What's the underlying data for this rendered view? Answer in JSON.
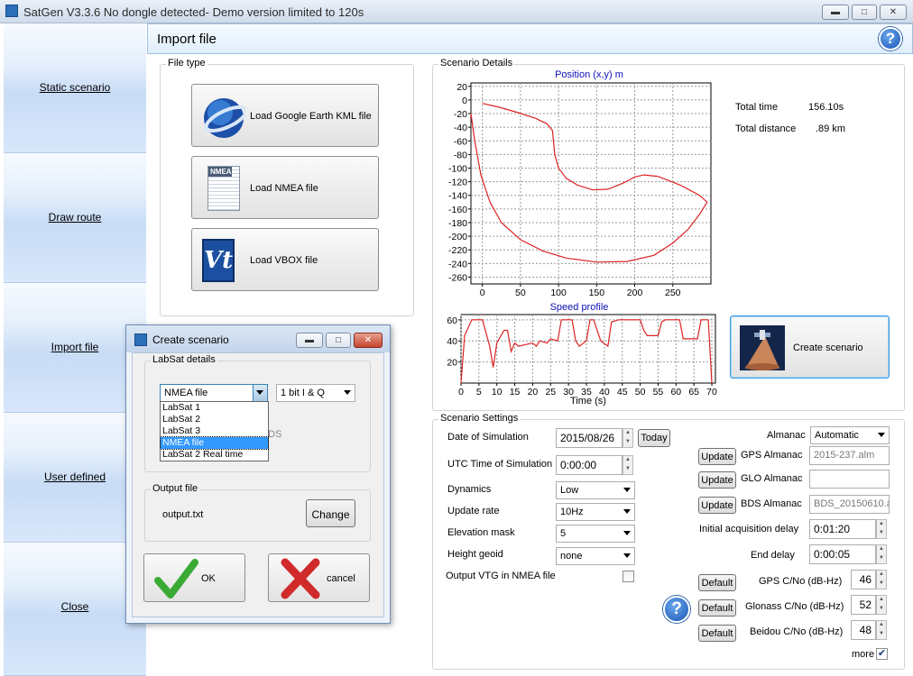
{
  "window": {
    "title": "SatGen V3.3.6 No dongle detected- Demo version limited to 120s",
    "min": "▬",
    "max": "□",
    "close": "✕"
  },
  "sidebar": {
    "items": [
      {
        "label": "Static scenario"
      },
      {
        "label": "Draw route"
      },
      {
        "label": "Import file"
      },
      {
        "label": "User defined"
      },
      {
        "label": "Close"
      }
    ]
  },
  "header": {
    "title": "Import file",
    "help": "?"
  },
  "file_type": {
    "legend": "File type",
    "buttons": [
      {
        "label": "Load Google Earth KML file",
        "icon": "google-earth-icon"
      },
      {
        "label": "Load NMEA file",
        "icon": "nmea-file-icon",
        "icon_text": "NMEA"
      },
      {
        "label": "Load VBOX file",
        "icon": "vbox-icon",
        "icon_text": "Vt"
      }
    ]
  },
  "scenario_details": {
    "legend": "Scenario Details",
    "total_time_label": "Total time",
    "total_time": "156.10s",
    "total_distance_label": "Total distance",
    "total_distance": ".89 km",
    "create_button": "Create scenario"
  },
  "chart_data": [
    {
      "type": "line",
      "title": "Position (x,y) m",
      "xlim": [
        -15,
        300
      ],
      "ylim": [
        -270,
        25
      ],
      "xticks": [
        0,
        50,
        100,
        150,
        200,
        250
      ],
      "yticks": [
        20,
        0,
        -20,
        -40,
        -60,
        -80,
        -100,
        -120,
        -140,
        -160,
        -180,
        -200,
        -220,
        -240,
        -260
      ],
      "grid": true,
      "color": "#dd2222",
      "series": [
        {
          "x": [
            0,
            20,
            45,
            70,
            85,
            92,
            95,
            100,
            110,
            125,
            145,
            165,
            185,
            200,
            212,
            230,
            260,
            285,
            295
          ],
          "y": [
            -5,
            -10,
            -18,
            -27,
            -35,
            -45,
            -80,
            -100,
            -115,
            -125,
            -132,
            -131,
            -122,
            -113,
            -110,
            -112,
            -125,
            -140,
            -150
          ]
        },
        {
          "x": [
            -15,
            -10,
            -2,
            10,
            25,
            50,
            80,
            110,
            150,
            190,
            225,
            250,
            270,
            285,
            295
          ],
          "y": [
            -20,
            -60,
            -110,
            -150,
            -180,
            -205,
            -222,
            -232,
            -238,
            -237,
            -228,
            -210,
            -190,
            -168,
            -150
          ]
        }
      ]
    },
    {
      "type": "line",
      "title": "Speed profile",
      "xlabel": "Time (s)",
      "xlim": [
        0,
        71
      ],
      "ylim": [
        0,
        65
      ],
      "xticks": [
        0,
        5,
        10,
        15,
        20,
        25,
        30,
        35,
        40,
        45,
        50,
        55,
        60,
        65,
        70
      ],
      "yticks": [
        60,
        40,
        20
      ],
      "grid": true,
      "color": "#dd2222",
      "series": [
        {
          "x": [
            0,
            1,
            3,
            6,
            8,
            9,
            10,
            12,
            13,
            14,
            15,
            16,
            20,
            21,
            22,
            24,
            25,
            27,
            28,
            31,
            32,
            33,
            35,
            36,
            37,
            39,
            41,
            42,
            44,
            45,
            50,
            51,
            52,
            55,
            56,
            57,
            61,
            62,
            66,
            67,
            69,
            70
          ],
          "y": [
            0,
            45,
            60,
            60,
            35,
            15,
            38,
            50,
            50,
            30,
            38,
            35,
            38,
            35,
            40,
            38,
            42,
            40,
            60,
            60,
            40,
            35,
            40,
            60,
            60,
            40,
            35,
            58,
            60,
            60,
            60,
            50,
            45,
            45,
            58,
            60,
            60,
            42,
            42,
            60,
            60,
            0
          ]
        }
      ]
    }
  ],
  "scenario_settings": {
    "legend": "Scenario Settings",
    "date_label": "Date of Simulation",
    "date_value": "2015/08/26",
    "today_button": "Today",
    "utc_label": "UTC Time of Simulation",
    "utc_value": "0:00:00",
    "dynamics_label": "Dynamics",
    "dynamics_value": "Low",
    "update_rate_label": "Update rate",
    "update_rate_value": "10Hz",
    "elevation_label": "Elevation mask",
    "elevation_value": "5",
    "height_label": "Height geoid",
    "height_value": "none",
    "vtg_label": "Output VTG in NMEA file",
    "almanac_label": "Almanac",
    "almanac_value": "Automatic",
    "update_button": "Update",
    "gps_almanac_label": "GPS Almanac",
    "gps_almanac_value": "2015-237.alm",
    "glo_almanac_label": "GLO Almanac",
    "glo_almanac_value": "",
    "bds_almanac_label": "BDS Almanac",
    "bds_almanac_value": "BDS_20150610.a",
    "init_acq_label": "Initial acquisition delay",
    "init_acq_value": "0:01:20",
    "end_delay_label": "End delay",
    "end_delay_value": "0:00:05",
    "default_button": "Default",
    "gps_cno_label": "GPS C/No (dB-Hz)",
    "gps_cno_value": "46",
    "glonass_cno_label": "Glonass C/No (dB-Hz)",
    "glonass_cno_value": "52",
    "beidou_cno_label": "Beidou C/No (dB-Hz)",
    "beidou_cno_value": "48",
    "more_label": "more"
  },
  "dialog": {
    "title": "Create scenario",
    "labsat_legend": "LabSat details",
    "type_value": "NMEA file",
    "type_options": [
      "LabSat 1",
      "LabSat 2",
      "LabSat 3",
      "NMEA file",
      "LabSat 2 Real time"
    ],
    "quant_value": "1 bit I & Q",
    "hidden_fragment": "DS",
    "output_legend": "Output file",
    "output_value": "output.txt",
    "change_button": "Change",
    "ok_button": "OK",
    "cancel_button": "cancel"
  }
}
